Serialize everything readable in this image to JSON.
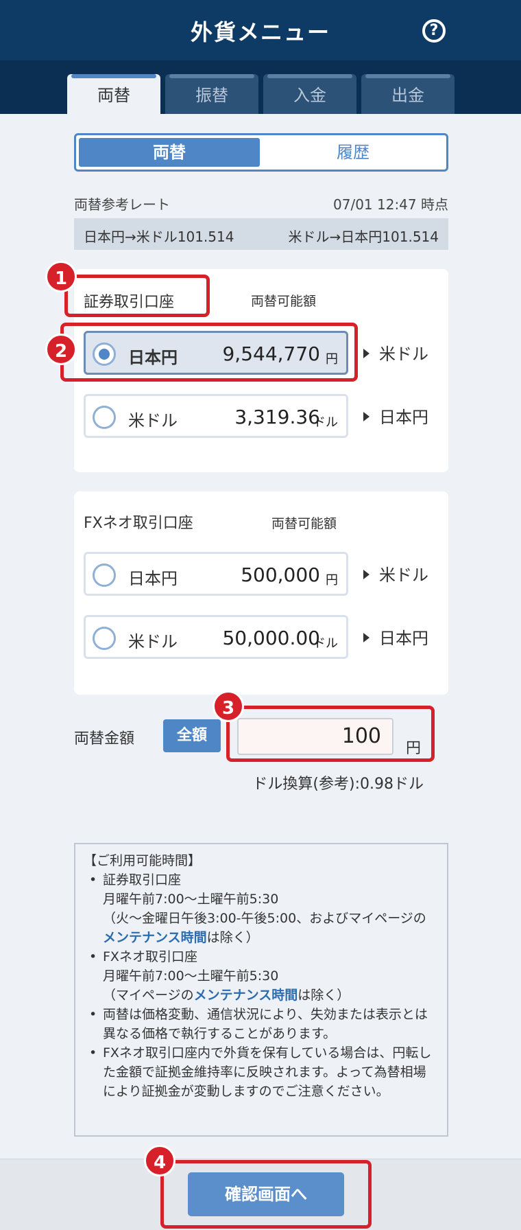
{
  "header": {
    "title": "外貨メニュー",
    "help_icon": "?"
  },
  "tabs": [
    {
      "label": "両替",
      "active": true
    },
    {
      "label": "振替"
    },
    {
      "label": "入金"
    },
    {
      "label": "出金"
    }
  ],
  "subtabs": [
    {
      "label": "両替",
      "active": true
    },
    {
      "label": "履歴"
    }
  ],
  "rate": {
    "label": "両替参考レート",
    "time": "07/01 12:47 時点",
    "jpy_to_usd": "日本円→米ドル101.514",
    "usd_to_jpy": "米ドル→日本円101.514"
  },
  "securities_account": {
    "title": "証券取引口座",
    "available_label": "両替可能額",
    "options": [
      {
        "currency": "日本円",
        "amount": "9,544,770",
        "unit": "円",
        "target": "米ドル",
        "selected": true
      },
      {
        "currency": "米ドル",
        "amount": "3,319.36",
        "unit": "ドル",
        "target": "日本円",
        "selected": false
      }
    ]
  },
  "fx_account": {
    "title": "FXネオ取引口座",
    "available_label": "両替可能額",
    "options": [
      {
        "currency": "日本円",
        "amount": "500,000",
        "unit": "円",
        "target": "米ドル",
        "selected": false
      },
      {
        "currency": "米ドル",
        "amount": "50,000.00",
        "unit": "ドル",
        "target": "日本円",
        "selected": false
      }
    ]
  },
  "exchange": {
    "label": "両替金額",
    "all_button": "全額",
    "amount": "100",
    "unit": "円",
    "conversion": "ドル換算(参考):0.98ドル"
  },
  "info": {
    "heading": "【ご利用可能時間】",
    "item1_title": "証券取引口座",
    "item1_line1": "月曜午前7:00～土曜午前5:30",
    "item1_line2_pre": "（火～金曜日午後3:00-午後5:00、およびマイページの",
    "item1_link": "メンテナンス時間",
    "item1_line2_post": "は除く）",
    "item2_title": "FXネオ取引口座",
    "item2_line1": "月曜午前7:00～土曜午前5:30",
    "item2_line2_pre": "（マイページの",
    "item2_link": "メンテナンス時間",
    "item2_line2_post": "は除く）",
    "item3": "両替は価格変動、通信状況により、失効または表示とは異なる価格で執行することがあります。",
    "item4": "FXネオ取引口座内で外貨を保有している場合は、円転した金額で証拠金維持率に反映されます。よって為替相場により証拠金が変動しますのでご注意ください。"
  },
  "footer": {
    "confirm_button": "確認画面へ"
  },
  "annotations": [
    "1",
    "2",
    "3",
    "4"
  ],
  "colors": {
    "header": "#0e3b66",
    "accent": "#4f86c6",
    "highlight": "#d6202a"
  }
}
